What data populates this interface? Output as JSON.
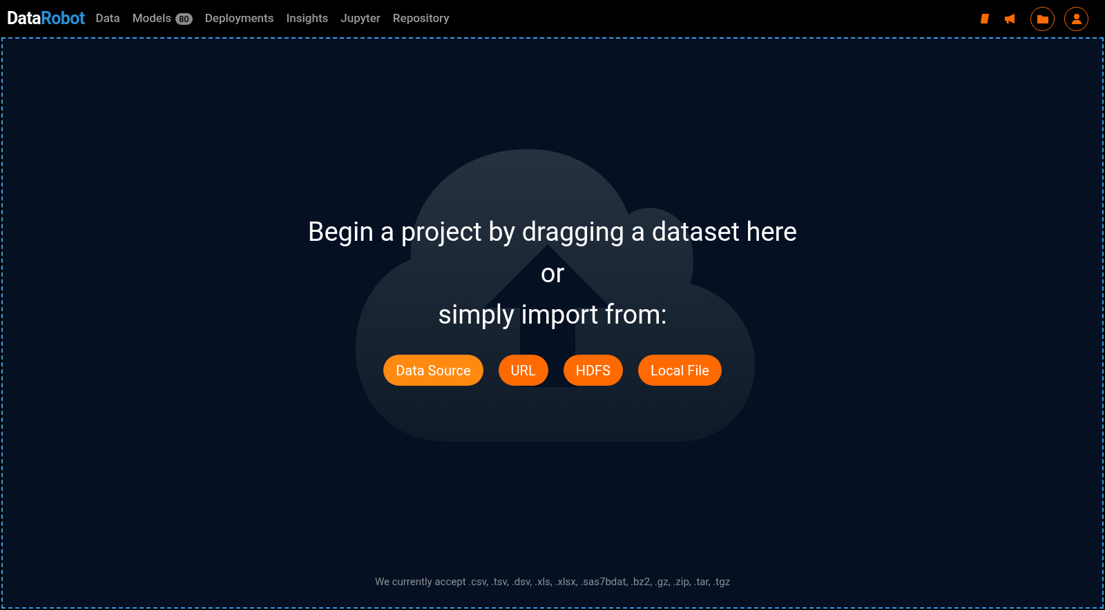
{
  "logo": {
    "part_1": "Data",
    "part_2": "Robot"
  },
  "nav": [
    {
      "label": "Data"
    },
    {
      "label": "Models",
      "badge": "80"
    },
    {
      "label": "Deployments"
    },
    {
      "label": "Insights"
    },
    {
      "label": "Jupyter"
    },
    {
      "label": "Repository"
    }
  ],
  "dropzone": {
    "heading_lines": [
      "Begin a project by dragging a dataset here",
      "or",
      "simply import from:"
    ],
    "buttons": [
      {
        "label": "Data Source",
        "hovered": true
      },
      {
        "label": "URL",
        "hovered": false
      },
      {
        "label": "HDFS",
        "hovered": false
      },
      {
        "label": "Local File",
        "hovered": false
      }
    ],
    "footnote": "We currently accept .csv, .tsv, .dsv, .xls, .xlsx, .sas7bdat, .bz2, .gz, .zip, .tar, .tgz"
  }
}
